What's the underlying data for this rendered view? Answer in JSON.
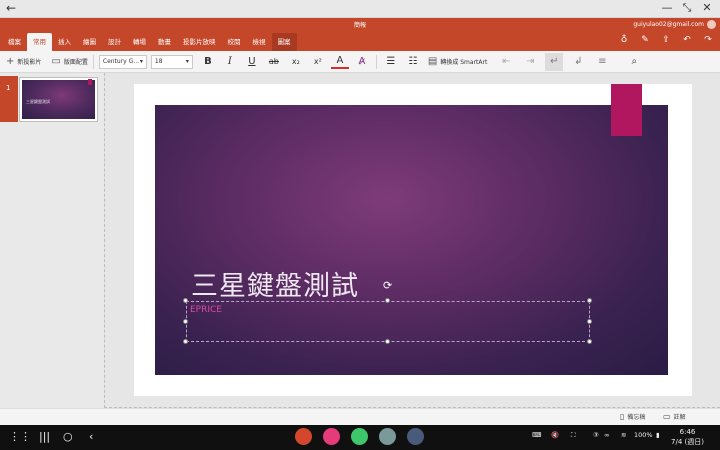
{
  "window": {
    "doc_title": "簡報",
    "account_email": "guiyulao02@gmail.com"
  },
  "ribbon": {
    "tabs": [
      "檔案",
      "常用",
      "插入",
      "繪圖",
      "設計",
      "轉場",
      "動畫",
      "投影片放映",
      "校閱",
      "檢視",
      "圖案"
    ],
    "active_tab": "常用"
  },
  "toolbar": {
    "new_slide_label": "新投影片",
    "layout_label": "版面配置",
    "font_name": "Century G...",
    "font_size": "18",
    "convert_smartart_label": "轉換成 SmartArt"
  },
  "thumbnails": {
    "slide_number": "1",
    "thumb_title": "三星鍵盤測試"
  },
  "slide": {
    "title": "三星鍵盤測試",
    "subtitle": "EPRICE"
  },
  "statusbar": {
    "notes_label": "備忘稿",
    "comments_label": "註解"
  },
  "system": {
    "battery": "100%",
    "time": "6:46",
    "date": "7/4 (週日)"
  },
  "colors": {
    "accent": "#c4472a",
    "slide_tag": "#b1175f",
    "subtitle": "#d44aa4"
  }
}
